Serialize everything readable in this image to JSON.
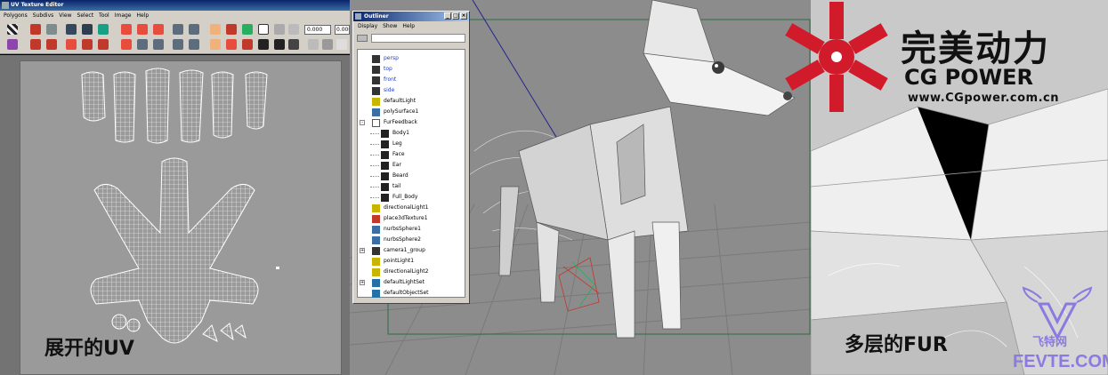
{
  "uv_editor": {
    "title": "UV Texture Editor",
    "menu": [
      "Polygons",
      "Subdivs",
      "View",
      "Select",
      "Tool",
      "Image",
      "Help"
    ],
    "field_u": "0.000",
    "field_v": "0.000",
    "caption": "展开的UV"
  },
  "outliner": {
    "title": "Outliner",
    "menu": [
      "Display",
      "Show",
      "Help"
    ],
    "items": [
      {
        "label": "persp",
        "icon": "camera-icon",
        "blue": true
      },
      {
        "label": "top",
        "icon": "camera-icon",
        "blue": true
      },
      {
        "label": "front",
        "icon": "camera-icon",
        "blue": true
      },
      {
        "label": "side",
        "icon": "camera-icon",
        "blue": true
      },
      {
        "label": "defaultLight",
        "icon": "light-icon",
        "blue": false
      },
      {
        "label": "polySurface1",
        "icon": "polysurface-icon",
        "blue": false
      },
      {
        "label": "FurFeedback",
        "icon": "fur-feedback-icon",
        "blue": false,
        "expand": "-"
      },
      {
        "label": "Body1",
        "icon": "fur-icon",
        "blue": false,
        "indent": true
      },
      {
        "label": "Leg",
        "icon": "fur-icon",
        "blue": false,
        "indent": true
      },
      {
        "label": "Face",
        "icon": "fur-icon",
        "blue": false,
        "indent": true
      },
      {
        "label": "Ear",
        "icon": "fur-icon",
        "blue": false,
        "indent": true
      },
      {
        "label": "Beard",
        "icon": "fur-icon",
        "blue": false,
        "indent": true
      },
      {
        "label": "tail",
        "icon": "fur-icon",
        "blue": false,
        "indent": true
      },
      {
        "label": "Full_Body",
        "icon": "fur-icon",
        "blue": false,
        "indent": true
      },
      {
        "label": "directionalLight1",
        "icon": "light-icon",
        "blue": false
      },
      {
        "label": "place3dTexture1",
        "icon": "texture-icon",
        "blue": false
      },
      {
        "label": "nurbsSphere1",
        "icon": "nurbs-icon",
        "blue": false
      },
      {
        "label": "nurbsSphere2",
        "icon": "nurbs-icon",
        "blue": false
      },
      {
        "label": "camera1_group",
        "icon": "camera-icon",
        "blue": false,
        "expand": "+"
      },
      {
        "label": "pointLight1",
        "icon": "point-light-icon",
        "blue": false
      },
      {
        "label": "directionalLight2",
        "icon": "light-icon",
        "blue": false
      },
      {
        "label": "defaultLightSet",
        "icon": "set-icon",
        "blue": false,
        "expand": "+"
      },
      {
        "label": "defaultObjectSet",
        "icon": "set-icon",
        "blue": false
      }
    ]
  },
  "closeup": {
    "caption": "多层的FUR"
  },
  "branding": {
    "cn": "完美动力",
    "en": "CG POWER",
    "url": "www.CGpower.com.cn",
    "watermark_cn": "飞特网",
    "watermark_en": "FEVTE.COM",
    "logo_color": "#d11a2a",
    "watermark_color": "#8c7ae0"
  }
}
